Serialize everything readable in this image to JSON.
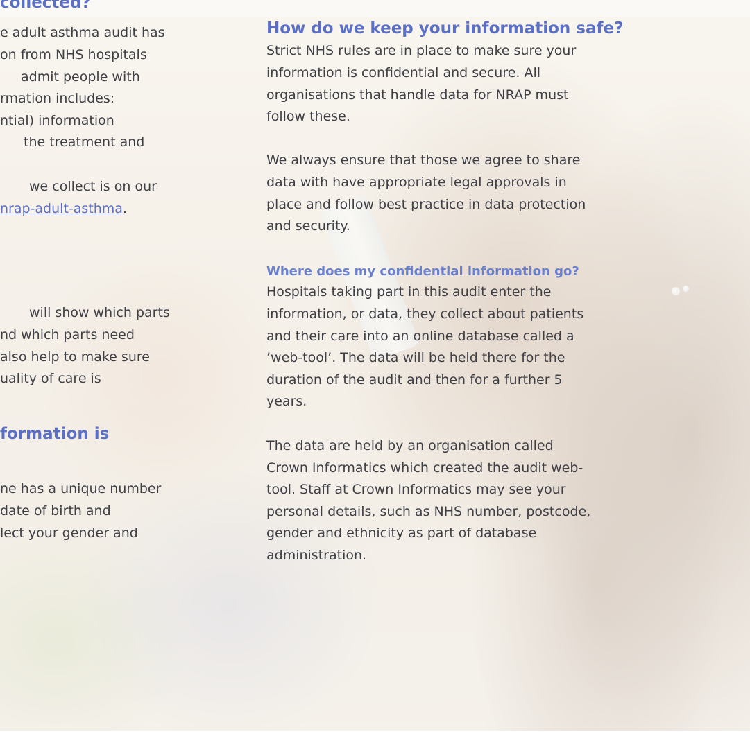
{
  "left_column": {
    "heading_top": "collected?",
    "intro_lines": [
      "e adult asthma audit has",
      "on from NHS hospitals",
      "admit people with",
      "rmation includes:",
      "ntial) information",
      "the treatment and"
    ],
    "website_line_1": "we collect is on our",
    "website_link": "nrap-adult-asthma",
    "website_period": ".",
    "benefit_lines": [
      "will show which parts",
      "nd which parts need",
      "also help to make sure",
      "uality of care is"
    ],
    "heading_identify": "formation is",
    "identifier_lines": [
      "ne has a unique number",
      "date of birth and",
      "lect your gender and"
    ]
  },
  "right_column": {
    "heading_safe": "How do we keep your information safe?",
    "safe_para_1": [
      "Strict NHS rules are in place to make sure your",
      "information is confidential and secure. All",
      "organisations that handle data for NRAP must",
      "follow these."
    ],
    "safe_para_2": [
      "We always ensure that those we agree to share",
      "data with have appropriate legal approvals in",
      "place and follow best practice in data protection",
      "and security."
    ],
    "subheading_where": "Where does my confidential information go?",
    "where_para_1": [
      "Hospitals taking part in this audit enter the",
      "information, or data, they collect about patients",
      "and their care into an online database called a",
      "’web-tool’. The data will be held there for the",
      "duration of the audit and then for a further 5",
      "years."
    ],
    "where_para_2": [
      "The data are held by an organisation called",
      "Crown Informatics which created the audit web-",
      "tool. Staff at Crown Informatics may see your",
      "personal details, such as NHS number, postcode,",
      "gender and ethnicity as part of database",
      "administration."
    ]
  },
  "colors": {
    "heading": "#5b6fc5",
    "body_text": "#3f3f46",
    "link": "#5b6fc5"
  }
}
